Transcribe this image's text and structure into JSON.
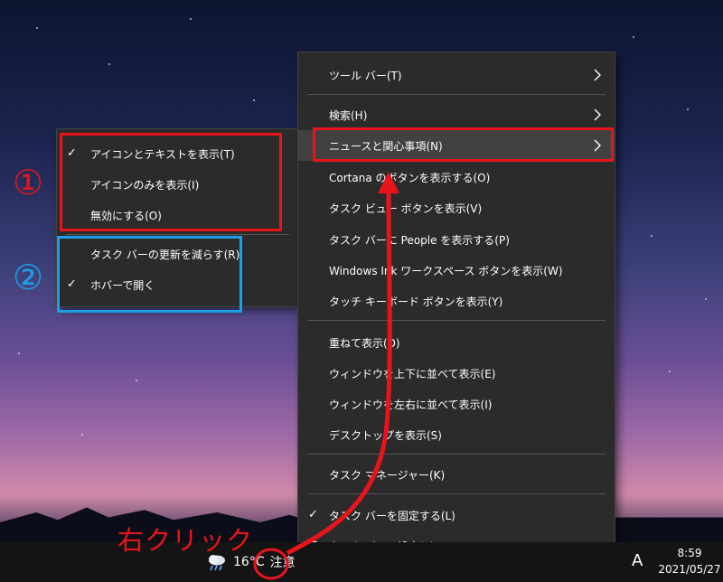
{
  "main_menu": {
    "items": [
      {
        "label": "ツール バー(T)",
        "submenu": true
      },
      {
        "label": "検索(H)",
        "submenu": true
      },
      {
        "label": "ニュースと関心事項(N)",
        "submenu": true,
        "highlight": true
      },
      {
        "label": "Cortana のボタンを表示する(O)"
      },
      {
        "label": "タスク ビュー ボタンを表示(V)"
      },
      {
        "label": "タスク バーに People を表示する(P)"
      },
      {
        "label": "Windows Ink ワークスペース ボタンを表示(W)"
      },
      {
        "label": "タッチ キーボード ボタンを表示(Y)"
      },
      {
        "label": "重ねて表示(D)"
      },
      {
        "label": "ウィンドウを上下に並べて表示(E)"
      },
      {
        "label": "ウィンドウを左右に並べて表示(I)"
      },
      {
        "label": "デスクトップを表示(S)"
      },
      {
        "label": "タスク マネージャー(K)"
      },
      {
        "label": "タスク バーを固定する(L)",
        "checked": true
      },
      {
        "label": "タスク バーの設定(T)",
        "icon": "gear-icon"
      }
    ]
  },
  "sub_menu": {
    "items": [
      {
        "label": "アイコンとテキストを表示(T)",
        "checked": true
      },
      {
        "label": "アイコンのみを表示(I)"
      },
      {
        "label": "無効にする(O)"
      },
      {
        "label": "タスク バーの更新を減らす(R)"
      },
      {
        "label": "ホバーで開く",
        "checked": true
      }
    ]
  },
  "annotations": {
    "label_1": "①",
    "label_2": "②",
    "right_click": "右クリック",
    "colors": {
      "red": "#e8141c",
      "blue": "#1aa0e8"
    }
  },
  "taskbar": {
    "weather_icon": "cloud-rain-icon",
    "temperature": "16°C",
    "weather_text": "注意",
    "ime": "A",
    "time": "8:59",
    "date": "2021/05/27"
  }
}
